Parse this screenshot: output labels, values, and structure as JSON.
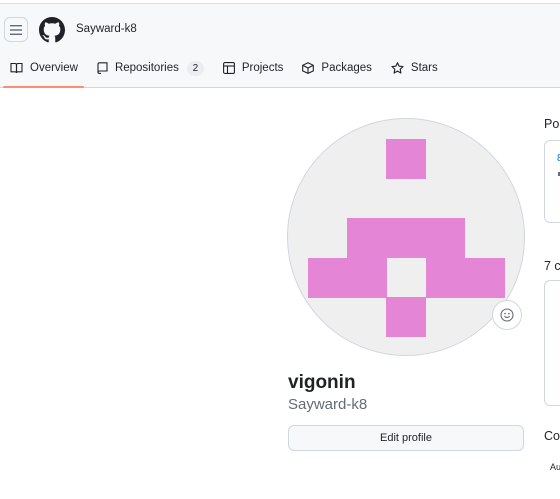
{
  "header": {
    "owner": "Sayward-k8",
    "icons": {
      "menu": "hamburger-icon",
      "logo": "github-mark-icon"
    }
  },
  "tabs": [
    {
      "label": "Overview",
      "icon": "book-icon",
      "selected": true
    },
    {
      "label": "Repositories",
      "icon": "repo-icon",
      "counter": "2"
    },
    {
      "label": "Projects",
      "icon": "table-icon"
    },
    {
      "label": "Packages",
      "icon": "package-icon"
    },
    {
      "label": "Stars",
      "icon": "star-icon"
    }
  ],
  "profile": {
    "display_name": "vigonin",
    "username": "Sayward-k8",
    "edit_label": "Edit profile",
    "avatar_color": "#e485d6",
    "status_icon": "smiley-icon"
  },
  "right_column": {
    "popular_heading": "Pop",
    "card_link_text": "8",
    "contributions_heading": "7 c",
    "contrib_settings_heading": "Co",
    "small_label": "Au"
  },
  "colors": {
    "selected_tab_underline": "#fd8c73",
    "link": "#0969da",
    "muted_text": "#636c76"
  }
}
